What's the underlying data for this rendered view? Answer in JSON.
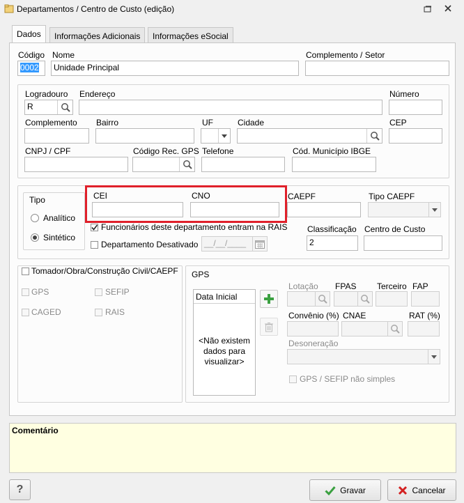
{
  "window": {
    "title": "Departamentos / Centro de Custo (edição)"
  },
  "tabs": [
    "Dados",
    "Informações Adicionais",
    "Informações eSocial"
  ],
  "fields": {
    "codigo": {
      "label": "Código",
      "value": "0002"
    },
    "nome": {
      "label": "Nome",
      "value": "Unidade Principal"
    },
    "complemento_setor": {
      "label": "Complemento / Setor",
      "value": ""
    },
    "logradouro": {
      "label": "Logradouro",
      "value": "R"
    },
    "endereco": {
      "label": "Endereço",
      "value": ""
    },
    "numero": {
      "label": "Número",
      "value": ""
    },
    "complemento": {
      "label": "Complemento",
      "value": ""
    },
    "bairro": {
      "label": "Bairro",
      "value": ""
    },
    "uf": {
      "label": "UF",
      "value": ""
    },
    "cidade": {
      "label": "Cidade",
      "value": ""
    },
    "cep": {
      "label": "CEP",
      "value": ""
    },
    "cnpj_cpf": {
      "label": "CNPJ / CPF",
      "value": ""
    },
    "codigo_rec_gps": {
      "label": "Código Rec. GPS",
      "value": ""
    },
    "telefone": {
      "label": "Telefone",
      "value": ""
    },
    "cod_municipio_ibge": {
      "label": "Cód. Município IBGE",
      "value": ""
    },
    "cei": {
      "label": "CEI",
      "value": ""
    },
    "cno": {
      "label": "CNO",
      "value": ""
    },
    "caepf": {
      "label": "CAEPF",
      "value": ""
    },
    "tipo_caepf": {
      "label": "Tipo CAEPF",
      "value": ""
    },
    "classificacao": {
      "label": "Classificação",
      "value": "2"
    },
    "centro_de_custo": {
      "label": "Centro de Custo",
      "value": ""
    }
  },
  "tipo": {
    "label": "Tipo",
    "options": [
      "Analítico",
      "Sintético"
    ],
    "selected": "Sintético"
  },
  "checks": {
    "funcionarios_rais": {
      "label": "Funcionários deste departamento entram na RAIS",
      "checked": true
    },
    "departamento_desativado": {
      "label": "Departamento Desativado",
      "checked": false,
      "date_placeholder": "__/__/____"
    }
  },
  "tomador": {
    "label": "Tomador/Obra/Construção Civil/CAEPF",
    "checked": false,
    "options": [
      "GPS",
      "SEFIP",
      "CAGED",
      "RAIS"
    ]
  },
  "gps": {
    "title": "GPS",
    "list_header": "Data Inicial",
    "empty_message": "<Não existem dados para visualizar>",
    "labels": {
      "lotacao": "Lotação",
      "fpas": "FPAS",
      "terceiro": "Terceiro",
      "fap": "FAP",
      "convenio": "Convênio (%)",
      "cnae": "CNAE",
      "rat": "RAT (%)",
      "desoneracao": "Desoneração",
      "nao_simples": "GPS / SEFIP não simples"
    }
  },
  "comentario": {
    "label": "Comentário",
    "value": ""
  },
  "buttons": {
    "help": "?",
    "gravar": "Gravar",
    "cancelar": "Cancelar"
  },
  "colors": {
    "highlight": "#e0202a",
    "comment_bg": "#ffffe1",
    "selection": "#3399ff",
    "add_green": "#3aa040",
    "cancel_red": "#d32020"
  }
}
